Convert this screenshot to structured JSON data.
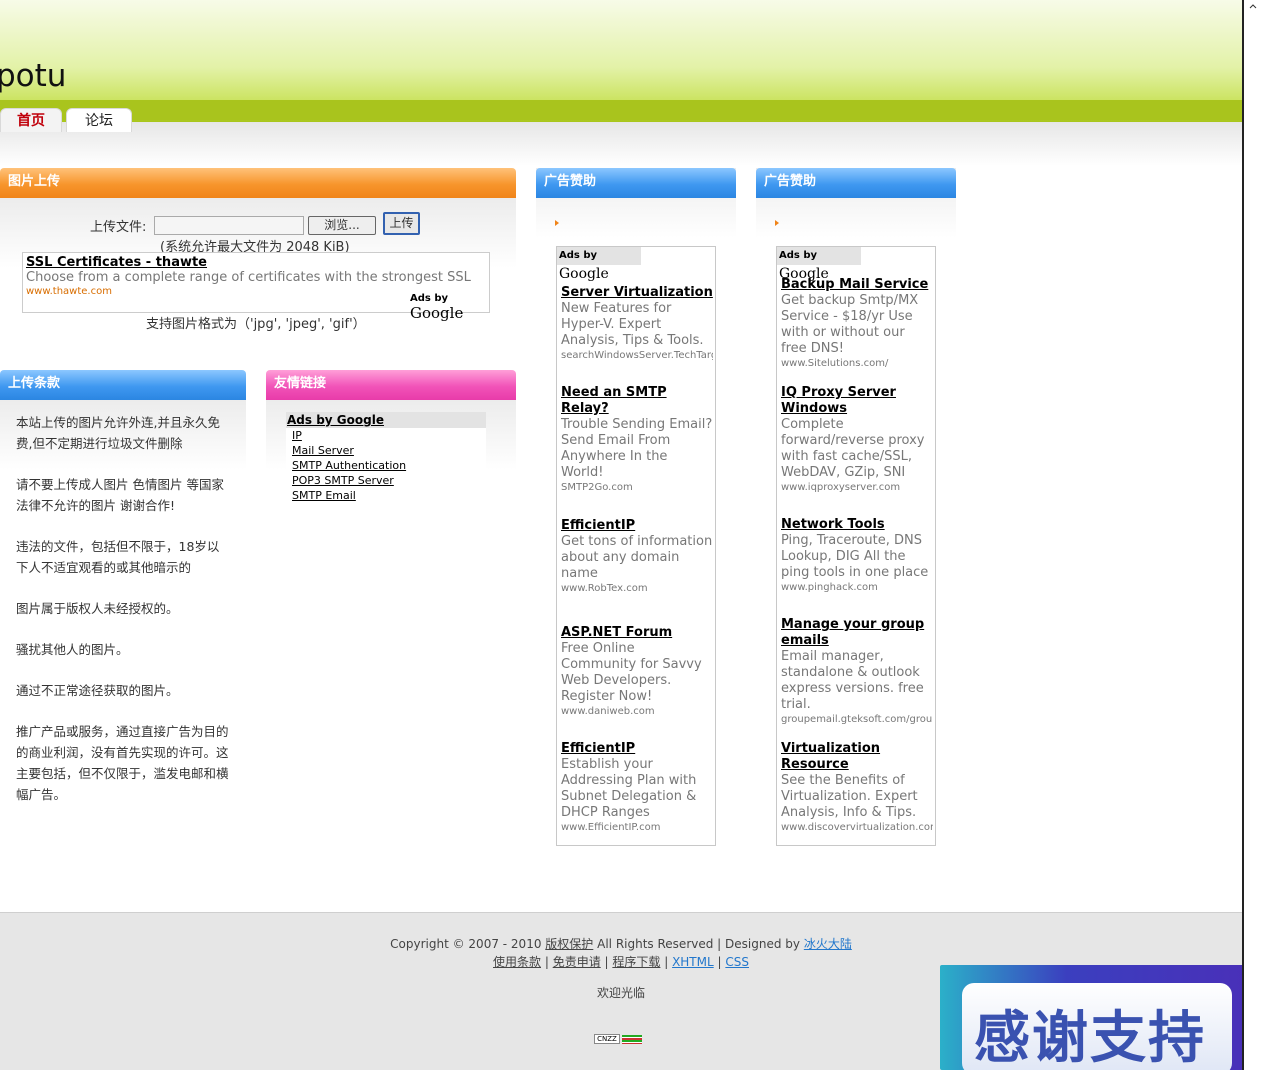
{
  "site": {
    "logo_text": "potu"
  },
  "nav": {
    "tabs": [
      {
        "label": "首页"
      },
      {
        "label": "论坛"
      }
    ]
  },
  "upload": {
    "title": "图片上传",
    "file_label": "上传文件:",
    "browse_label": "浏览...",
    "upload_label": "上传",
    "max_note": "(系统允许最大文件为  2048 KiB)",
    "formats_note": "支持图片格式为（'jpg', 'jpeg', 'gif'）",
    "ad": {
      "title": "SSL Certificates - thawte",
      "desc": "Choose from a complete range of certificates with the strongest SSL",
      "url": "www.thawte.com",
      "ads_by": "Ads by",
      "google": "Google"
    }
  },
  "terms": {
    "title": "上传条款",
    "paragraphs": [
      "本站上传的图片允许外连,并且永久免费,但不定期进行垃圾文件删除",
      "请不要上传成人图片 色情图片 等国家法律不允许的图片 谢谢合作!",
      "违法的文件，包括但不限于，18岁以下人不适宜观看的或其他暗示的",
      "图片属于版权人未经授权的。",
      "骚扰其他人的图片。",
      "通过不正常途径获取的图片。",
      "推广产品或服务，通过直接广告为目的的商业利润，没有首先实现的许可。这主要包括，但不仅限于，滥发电邮和横幅广告。"
    ]
  },
  "links": {
    "title": "友情链接",
    "ads_header": "Ads by Google",
    "items": [
      "IP",
      "Mail Server",
      "SMTP Authentication",
      "POP3 SMTP Server",
      "SMTP Email"
    ]
  },
  "sponsor1": {
    "title": "广告赞助",
    "ads_by": "Ads by",
    "google": "Google",
    "ads": [
      {
        "title": "Server Virtualization",
        "desc": "New Features for Hyper-V. Expert Analysis, Tips & Tools.",
        "url": "searchWindowsServer.TechTarget.com"
      },
      {
        "title": "Need an SMTP Relay?",
        "desc": "Trouble Sending Email? Send Email From Anywhere In the World!",
        "url": "SMTP2Go.com"
      },
      {
        "title": "EfficientIP",
        "desc": "Get tons of information about any domain name",
        "url": "www.RobTex.com"
      },
      {
        "title": "ASP.NET Forum",
        "desc": "Free Online Community for Savvy Web Developers. Register Now!",
        "url": "www.daniweb.com"
      },
      {
        "title": "EfficientIP",
        "desc": "Establish your Addressing Plan with Subnet Delegation & DHCP Ranges",
        "url": "www.EfficientIP.com"
      }
    ]
  },
  "sponsor2": {
    "title": "广告赞助",
    "ads_by": "Ads by",
    "google": "Google",
    "ads": [
      {
        "title": "Backup Mail Service",
        "desc": "Get backup Smtp/MX Service - $18/yr Use with or without our free DNS!",
        "url": "www.Sitelutions.com/"
      },
      {
        "title": "IQ Proxy Server Windows",
        "desc": "Complete forward/reverse proxy with fast cache/SSL, WebDAV, GZip, SNI",
        "url": "www.iqproxyserver.com"
      },
      {
        "title": "Network Tools",
        "desc": "Ping, Traceroute, DNS Lookup, DIG All the ping tools in one place",
        "url": "www.pinghack.com"
      },
      {
        "title": "Manage your group emails",
        "desc": "Email manager, standalone & outlook express versions. free trial.",
        "url": "groupemail.gteksoft.com/groupemail"
      },
      {
        "title": "Virtualization Resource",
        "desc": "See the Benefits of Virtualization. Expert Analysis, Info & Tips.",
        "url": "www.discovervirtualization.com"
      }
    ]
  },
  "footer": {
    "copyright_prefix": "Copyright © 2007 - 2010",
    "copyright_link": "版权保护",
    "rights": "All Rights Reserved | Designed by",
    "designer": "冰火大陆",
    "links": [
      "使用条款",
      "免责申请",
      "程序下载",
      "XHTML",
      "CSS"
    ],
    "welcome": "欢迎光临",
    "counter": "CNZZ"
  },
  "thanks": {
    "text": "感谢支持"
  },
  "colors": {
    "orange_head": "#f08419",
    "blue_head": "#2b86e2",
    "pink_head": "#e83ba9",
    "header_green": "#a9c41d",
    "home_tab_red": "#c0000b"
  }
}
